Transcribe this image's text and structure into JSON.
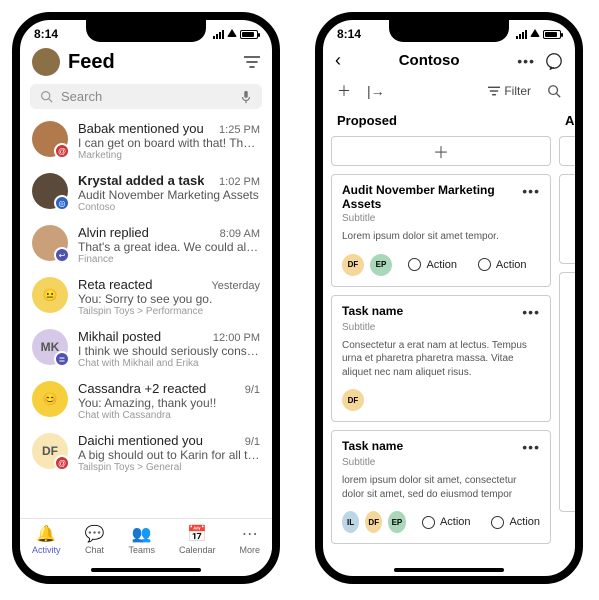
{
  "status": {
    "time": "8:14"
  },
  "feed": {
    "title": "Feed",
    "search_placeholder": "Search",
    "items": [
      {
        "title": "Babak mentioned you",
        "bold": false,
        "time": "1:25 PM",
        "text": "I can get on board with that! Thanks f...",
        "sub": "Marketing",
        "avatar_bg": "#b07a4d",
        "avatar_txt": "",
        "badge_bg": "#d13438",
        "badge_glyph": "@"
      },
      {
        "title": "Krystal added a task",
        "bold": true,
        "time": "1:02 PM",
        "text": "Audit November Marketing Assets",
        "sub": "Contoso",
        "avatar_bg": "#5b4a3a",
        "avatar_txt": "",
        "badge_bg": "#2a63c9",
        "badge_glyph": "◎"
      },
      {
        "title": "Alvin replied",
        "bold": false,
        "time": "8:09 AM",
        "text": "That's a great idea. We could also get...",
        "sub": "Finance",
        "avatar_bg": "#caa07a",
        "avatar_txt": "",
        "badge_bg": "#4f52b2",
        "badge_glyph": "↩"
      },
      {
        "title": "Reta reacted",
        "bold": false,
        "time": "Yesterday",
        "text": "You: Sorry to see you go.",
        "sub": "Tailspin Toys > Performance",
        "avatar_bg": "#f4d35e",
        "avatar_txt": "😐",
        "badge_bg": "#fff",
        "badge_glyph": ""
      },
      {
        "title": "Mikhail posted",
        "bold": false,
        "time": "12:00 PM",
        "text": "I think we should seriously consider if...",
        "sub": "Chat with Mikhail and Erika",
        "avatar_bg": "#d6c9e8",
        "avatar_txt": "MK",
        "badge_bg": "#4f52b2",
        "badge_glyph": "≣"
      },
      {
        "title": "Cassandra +2 reacted",
        "bold": false,
        "time": "9/1",
        "text": "You: Amazing, thank you!!",
        "sub": "Chat with Cassandra",
        "avatar_bg": "#f7cf3c",
        "avatar_txt": "😊",
        "badge_bg": "#fff",
        "badge_glyph": ""
      },
      {
        "title": "Daichi mentioned you",
        "bold": false,
        "time": "9/1",
        "text": "A big should out to Karin for all the ha...",
        "sub": "Tailspin Toys > General",
        "avatar_bg": "#f8e6b5",
        "avatar_txt": "DF",
        "badge_bg": "#d13438",
        "badge_glyph": "@"
      }
    ],
    "tabs": [
      {
        "label": "Activity",
        "glyph": "🔔",
        "active": true
      },
      {
        "label": "Chat",
        "glyph": "💬",
        "active": false
      },
      {
        "label": "Teams",
        "glyph": "👥",
        "active": false
      },
      {
        "label": "Calendar",
        "glyph": "📅",
        "active": false
      },
      {
        "label": "More",
        "glyph": "⋯",
        "active": false
      }
    ]
  },
  "board": {
    "title": "Contoso",
    "filter_label": "Filter",
    "col1_header": "Proposed",
    "col2_header": "Act",
    "cards": [
      {
        "title": "Audit November Marketing Assets",
        "subtitle": "Subtitle",
        "body": "Lorem ipsum dolor sit amet tempor.",
        "chips": [
          {
            "t": "DF",
            "bg": "#f4d79a"
          },
          {
            "t": "EP",
            "bg": "#a8d8b9"
          }
        ],
        "actions": [
          "Action",
          "Action"
        ]
      },
      {
        "title": "Task name",
        "subtitle": "Subtitle",
        "body": "Consectetur a erat nam at lectus. Tempus urna et pharetra pharetra massa. Vitae aliquet nec nam aliquet risus.",
        "chips": [
          {
            "t": "DF",
            "bg": "#f4d79a"
          }
        ],
        "actions": []
      },
      {
        "title": "Task name",
        "subtitle": "Subtitle",
        "body": "lorem ipsum dolor sit amet, consectetur dolor sit amet, sed do eiusmod tempor",
        "chips": [
          {
            "t": "IL",
            "bg": "#bcd6e5"
          },
          {
            "t": "DF",
            "bg": "#f4d79a"
          },
          {
            "t": "EP",
            "bg": "#a8d8b9"
          }
        ],
        "actions": [
          "Action",
          "Action"
        ]
      }
    ]
  }
}
